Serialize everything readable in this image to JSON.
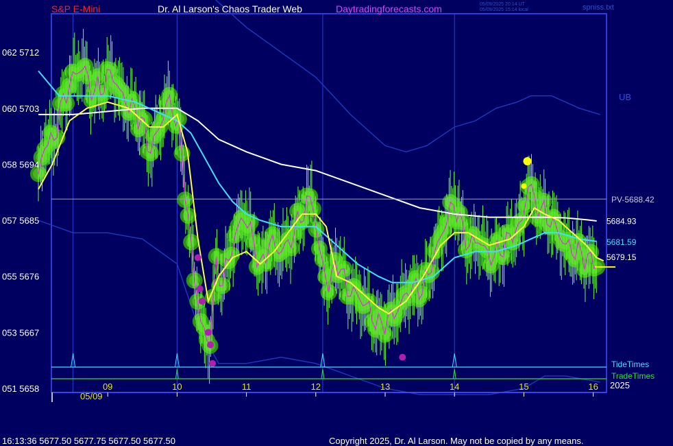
{
  "header": {
    "symbol": "S&P E-Mini",
    "site_title": "Dr. Al Larson's Chaos Trader Web",
    "site_url": "Daytradingforecasts.com",
    "timestamp_utc": "05/09/2025 20:14 UT",
    "timestamp_local": "05/09/2025 15:14 local",
    "file_name": "spniss.txt",
    "colors": {
      "symbol": "#ff2020",
      "title": "#ffffff",
      "url": "#e040ff"
    }
  },
  "footer": {
    "quote_line": "16:13:36  5677.50  5677.75  5677.50  5677.50",
    "copyright": "Copyright 2025, Dr. Al Larson. May not be copied by any means."
  },
  "chart_data": {
    "type": "line",
    "title": "S&P E-Mini",
    "x_date_label": "05/09",
    "x_ticks": [
      "09",
      "10",
      "11",
      "12",
      "13",
      "14",
      "15",
      "16"
    ],
    "xlim": [
      8.0,
      16.1
    ],
    "ylim": [
      5658,
      5720
    ],
    "y_ticks_price": [
      5658,
      5667,
      5676,
      5685,
      5694,
      5703,
      5712
    ],
    "y_ticks_alt": [
      "051",
      "053",
      "055",
      "057",
      "058",
      "060",
      "062"
    ],
    "y_tick_labels": [
      "051  5658",
      "053  5667",
      "055  5676",
      "057  5685",
      "058  5694",
      "060  5703",
      "062  5712"
    ],
    "pivot_line": {
      "value": 5688.42,
      "label": "PV-5688.42"
    },
    "vertical_lines": [
      8.5,
      10.0,
      12.1,
      14.0
    ],
    "tide_times": {
      "label": "TideTimes",
      "times": [
        8.5,
        10.0,
        12.1,
        14.0
      ]
    },
    "trade_times": {
      "label": "TradeTimes",
      "times": [
        10.0,
        12.1,
        14.0
      ]
    },
    "year_label": "2025",
    "band_label": "UB",
    "end_labels": {
      "white": "5684.93",
      "cyan": "5681.59",
      "yellow": "5679.15"
    },
    "series": [
      {
        "role": "price",
        "x": [
          8.0,
          8.1,
          8.2,
          8.35,
          8.5,
          8.65,
          8.75,
          8.9,
          9.05,
          9.2,
          9.35,
          9.5,
          9.6,
          9.75,
          9.85,
          9.95,
          10.05,
          10.15,
          10.25,
          10.35,
          10.45,
          10.5,
          10.55,
          10.65,
          10.8,
          10.95,
          11.1,
          11.2,
          11.35,
          11.45,
          11.6,
          11.8,
          11.95,
          12.0,
          12.05,
          12.2,
          12.3,
          12.45,
          12.6,
          12.75,
          12.9,
          13.05,
          13.2,
          13.35,
          13.55,
          13.7,
          13.85,
          14.0,
          14.1,
          14.2,
          14.35,
          14.5,
          14.65,
          14.85,
          15.0,
          15.05,
          15.15,
          15.3,
          15.45,
          15.6,
          15.75,
          15.9,
          16.05
        ],
        "y": [
          5692,
          5698,
          5697,
          5704,
          5708,
          5710,
          5706,
          5706,
          5709,
          5705,
          5703,
          5701,
          5696,
          5700,
          5704,
          5703,
          5698,
          5686,
          5676,
          5668,
          5665,
          5668,
          5678,
          5675,
          5681,
          5686,
          5682,
          5677,
          5682,
          5680,
          5681,
          5686,
          5689,
          5684,
          5680,
          5674,
          5679,
          5674,
          5673,
          5671,
          5668,
          5669,
          5671,
          5674,
          5674,
          5679,
          5684,
          5688,
          5684,
          5681,
          5682,
          5679,
          5680,
          5683,
          5685,
          5692,
          5688,
          5686,
          5684,
          5681,
          5680,
          5679,
          5678
        ]
      },
      {
        "role": "fast-average",
        "color": "#ffff40",
        "x": [
          8.0,
          8.2,
          8.45,
          8.7,
          9.0,
          9.3,
          9.6,
          9.8,
          10.0,
          10.15,
          10.3,
          10.45,
          10.6,
          10.8,
          11.0,
          11.2,
          11.4,
          11.6,
          11.8,
          12.0,
          12.15,
          12.3,
          12.5,
          12.7,
          12.9,
          13.05,
          13.3,
          13.55,
          13.8,
          14.0,
          14.2,
          14.5,
          14.8,
          15.0,
          15.15,
          15.3,
          15.5,
          15.7,
          15.9,
          16.05,
          16.15
        ],
        "y": [
          5690,
          5694,
          5701,
          5703,
          5704,
          5703,
          5700,
          5700,
          5702,
          5696,
          5682,
          5672,
          5676,
          5679,
          5680,
          5678,
          5680,
          5683,
          5686,
          5686,
          5684,
          5676,
          5675,
          5673,
          5671,
          5670,
          5672,
          5676,
          5681,
          5683,
          5683,
          5681,
          5682,
          5684,
          5687,
          5686,
          5685,
          5683,
          5681,
          5679,
          5678.5
        ]
      },
      {
        "role": "medium-average",
        "color": "#40e0ff",
        "x": [
          8.0,
          8.3,
          8.6,
          9.0,
          9.4,
          9.8,
          10.0,
          10.2,
          10.4,
          10.6,
          10.8,
          11.0,
          11.2,
          11.5,
          11.8,
          12.0,
          12.3,
          12.6,
          12.9,
          13.1,
          13.4,
          13.7,
          14.0,
          14.3,
          14.6,
          14.9,
          15.1,
          15.3,
          15.5,
          15.8,
          16.05
        ],
        "y": [
          5709,
          5705,
          5705,
          5705,
          5704,
          5702,
          5701,
          5699,
          5695,
          5691,
          5688,
          5686,
          5685,
          5684,
          5684,
          5684,
          5681,
          5678,
          5676,
          5675,
          5675,
          5676,
          5679,
          5680,
          5680,
          5681,
          5682,
          5683,
          5683,
          5682,
          5681.6
        ]
      },
      {
        "role": "slow-average",
        "color": "#ffffff",
        "x": [
          8.0,
          8.5,
          9.0,
          9.5,
          10.0,
          10.3,
          10.6,
          11.0,
          11.5,
          12.0,
          12.5,
          13.0,
          13.5,
          14.0,
          14.5,
          15.0,
          15.3,
          15.6,
          15.9,
          16.05
        ],
        "y": [
          5702,
          5702,
          5702.5,
          5703,
          5703,
          5701,
          5698,
          5696,
          5694,
          5693,
          5691,
          5689,
          5687,
          5686,
          5685.5,
          5685.5,
          5685.5,
          5685.4,
          5685.1,
          5684.9
        ]
      },
      {
        "role": "upper-band",
        "color": "#2038c0",
        "x": [
          8.0,
          8.6,
          9.0,
          9.6,
          10.0,
          10.3,
          10.6,
          11.0,
          11.5,
          12.0,
          12.5,
          13.0,
          13.3,
          13.6,
          14.0,
          14.3,
          14.6,
          14.9,
          15.1,
          15.4,
          15.8,
          16.1
        ],
        "y": [
          5722,
          5722,
          5724,
          5724,
          5724,
          5723,
          5720,
          5716,
          5712,
          5708,
          5702,
          5697,
          5696,
          5697,
          5700,
          5701,
          5703,
          5704,
          5705,
          5705,
          5703,
          5702
        ]
      },
      {
        "role": "lower-band",
        "color": "#2038c0",
        "x": [
          8.0,
          8.5,
          9.0,
          9.5,
          10.0,
          10.3,
          10.6,
          11.0,
          11.5,
          12.0,
          12.5,
          13.0,
          13.5,
          14.0,
          14.5,
          15.0,
          15.3,
          15.6,
          16.1
        ],
        "y": [
          5685,
          5683,
          5683,
          5682,
          5678,
          5668,
          5662,
          5662,
          5663,
          5662,
          5660,
          5658,
          5657,
          5657,
          5657,
          5658,
          5660,
          5660,
          5659
        ]
      }
    ],
    "magenta_dots": [
      [
        10.3,
        5679
      ],
      [
        10.33,
        5674
      ],
      [
        10.36,
        5672
      ],
      [
        10.45,
        5667
      ],
      [
        10.48,
        5665
      ],
      [
        10.51,
        5662
      ],
      [
        13.25,
        5663
      ]
    ],
    "yellow_dots": [
      [
        15.05,
        5694.5
      ],
      [
        15.0,
        5690.5
      ]
    ]
  }
}
